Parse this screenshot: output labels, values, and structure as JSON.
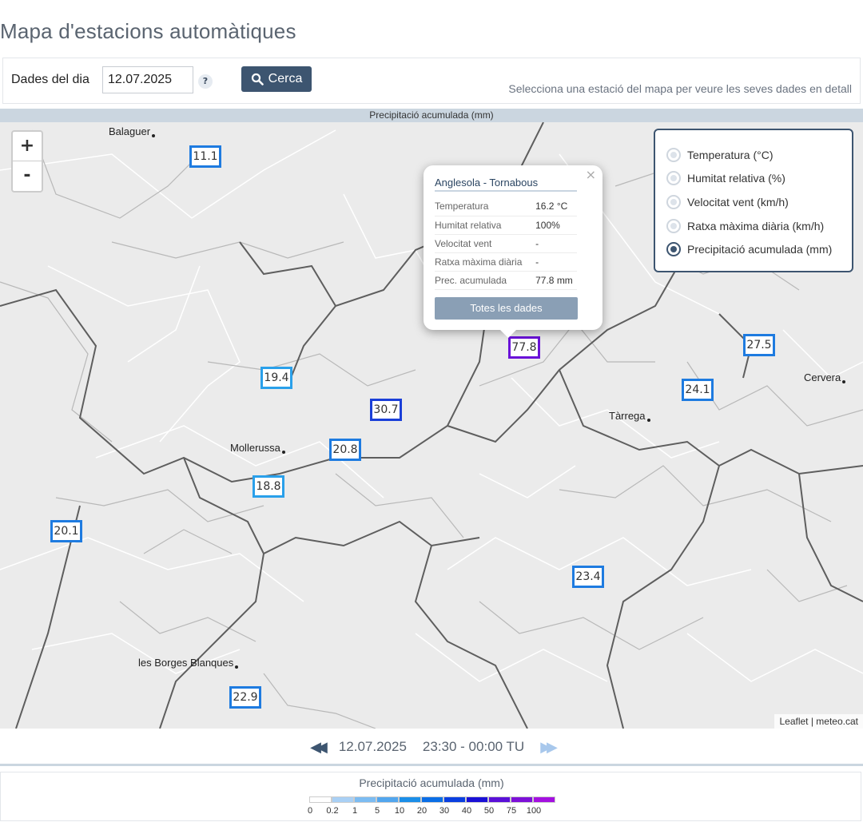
{
  "page": {
    "title": "Mapa d'estacions automàtiques"
  },
  "toolbar": {
    "day_label": "Dades del dia",
    "date_value": "12.07.2025",
    "help_symbol": "?",
    "search_label": "Cerca",
    "hint": "Selecciona una estació del mapa per veure les seves dades en detall"
  },
  "map": {
    "header": "Precipitació acumulada (mm)",
    "zoom_in": "+",
    "zoom_out": "-",
    "attribution": "Leaflet | meteo.cat",
    "cities": [
      "Balaguer",
      "Mollerussa",
      "Tàrrega",
      "Cervera",
      "les Borges Blanques"
    ],
    "markers": [
      "11.1",
      "77.8",
      "27.5",
      "19.4",
      "24.1",
      "30.7",
      "20.8",
      "18.8",
      "20.1",
      "23.4",
      "22.9"
    ]
  },
  "popup": {
    "close": "×",
    "station": "Anglesola - Tornabous",
    "rows": [
      {
        "label": "Temperatura",
        "value": "16.2 °C"
      },
      {
        "label": "Humitat relativa",
        "value": "100%"
      },
      {
        "label": "Velocitat vent",
        "value": "-"
      },
      {
        "label": "Ratxa màxima diària",
        "value": "-"
      },
      {
        "label": "Prec. acumulada",
        "value": "77.8 mm"
      }
    ],
    "button": "Totes les dades"
  },
  "layers": {
    "options": [
      {
        "label": "Temperatura (°C)",
        "selected": false
      },
      {
        "label": "Humitat relativa (%)",
        "selected": false
      },
      {
        "label": "Velocitat vent (km/h)",
        "selected": false
      },
      {
        "label": "Ratxa màxima diària (km/h)",
        "selected": false
      },
      {
        "label": "Precipitació acumulada (mm)",
        "selected": true
      }
    ]
  },
  "timebar": {
    "date": "12.07.2025",
    "time": "23:30 - 00:00 TU"
  },
  "legend": {
    "title": "Precipitació acumulada (mm)",
    "ticks": [
      "0",
      "0.2",
      "1",
      "5",
      "10",
      "20",
      "30",
      "40",
      "50",
      "75",
      "100"
    ],
    "colors": [
      "#ffffff",
      "#a9d0f5",
      "#7cbcf2",
      "#52a6ee",
      "#1b8ee8",
      "#0a6ee6",
      "#0a3fe0",
      "#1a10d6",
      "#5a10d8",
      "#7d10d8",
      "#a410e0"
    ]
  }
}
